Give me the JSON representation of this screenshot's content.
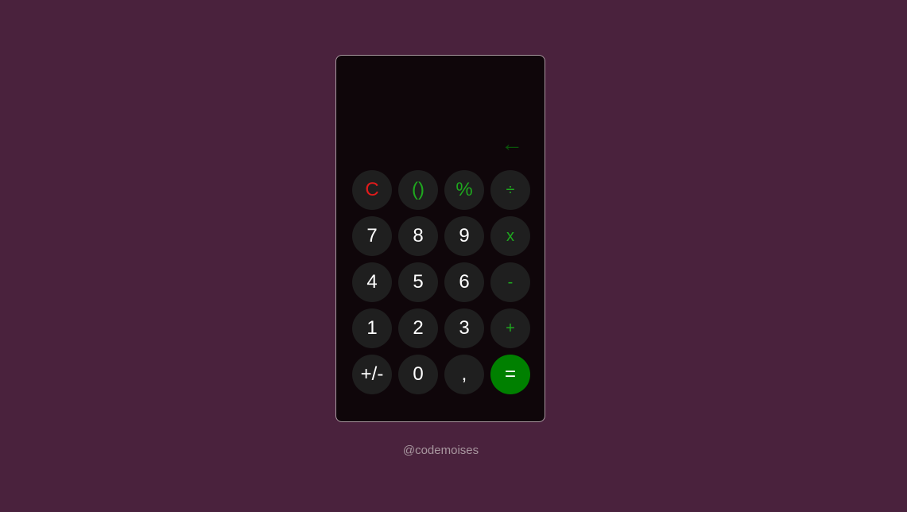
{
  "calculator": {
    "display_value": "",
    "backspace_symbol": "←",
    "keys": [
      {
        "label": "C",
        "name": "clear-button",
        "kind": "clear"
      },
      {
        "label": "()",
        "name": "parentheses-button",
        "kind": "op"
      },
      {
        "label": "%",
        "name": "percent-button",
        "kind": "op"
      },
      {
        "label": "÷",
        "name": "divide-button",
        "kind": "op-small"
      },
      {
        "label": "7",
        "name": "digit-7-button",
        "kind": "digit"
      },
      {
        "label": "8",
        "name": "digit-8-button",
        "kind": "digit"
      },
      {
        "label": "9",
        "name": "digit-9-button",
        "kind": "digit"
      },
      {
        "label": "x",
        "name": "multiply-button",
        "kind": "op-small"
      },
      {
        "label": "4",
        "name": "digit-4-button",
        "kind": "digit"
      },
      {
        "label": "5",
        "name": "digit-5-button",
        "kind": "digit"
      },
      {
        "label": "6",
        "name": "digit-6-button",
        "kind": "digit"
      },
      {
        "label": "-",
        "name": "subtract-button",
        "kind": "op-small"
      },
      {
        "label": "1",
        "name": "digit-1-button",
        "kind": "digit"
      },
      {
        "label": "2",
        "name": "digit-2-button",
        "kind": "digit"
      },
      {
        "label": "3",
        "name": "digit-3-button",
        "kind": "digit"
      },
      {
        "label": "+",
        "name": "add-button",
        "kind": "op-small"
      },
      {
        "label": "+/-",
        "name": "toggle-sign-button",
        "kind": "digit"
      },
      {
        "label": "0",
        "name": "digit-0-button",
        "kind": "digit"
      },
      {
        "label": ",",
        "name": "decimal-button",
        "kind": "digit"
      },
      {
        "label": "=",
        "name": "equals-button",
        "kind": "equals"
      }
    ]
  },
  "footer": {
    "credit": "@codemoises"
  },
  "colors": {
    "background": "#4a223d",
    "calculator_body": "#0f060a",
    "key": "#1f1f1f",
    "operator_text": "#1fa81f",
    "clear_text": "#e01b1b",
    "equals_background": "#008000",
    "backspace": "#0a520a"
  }
}
